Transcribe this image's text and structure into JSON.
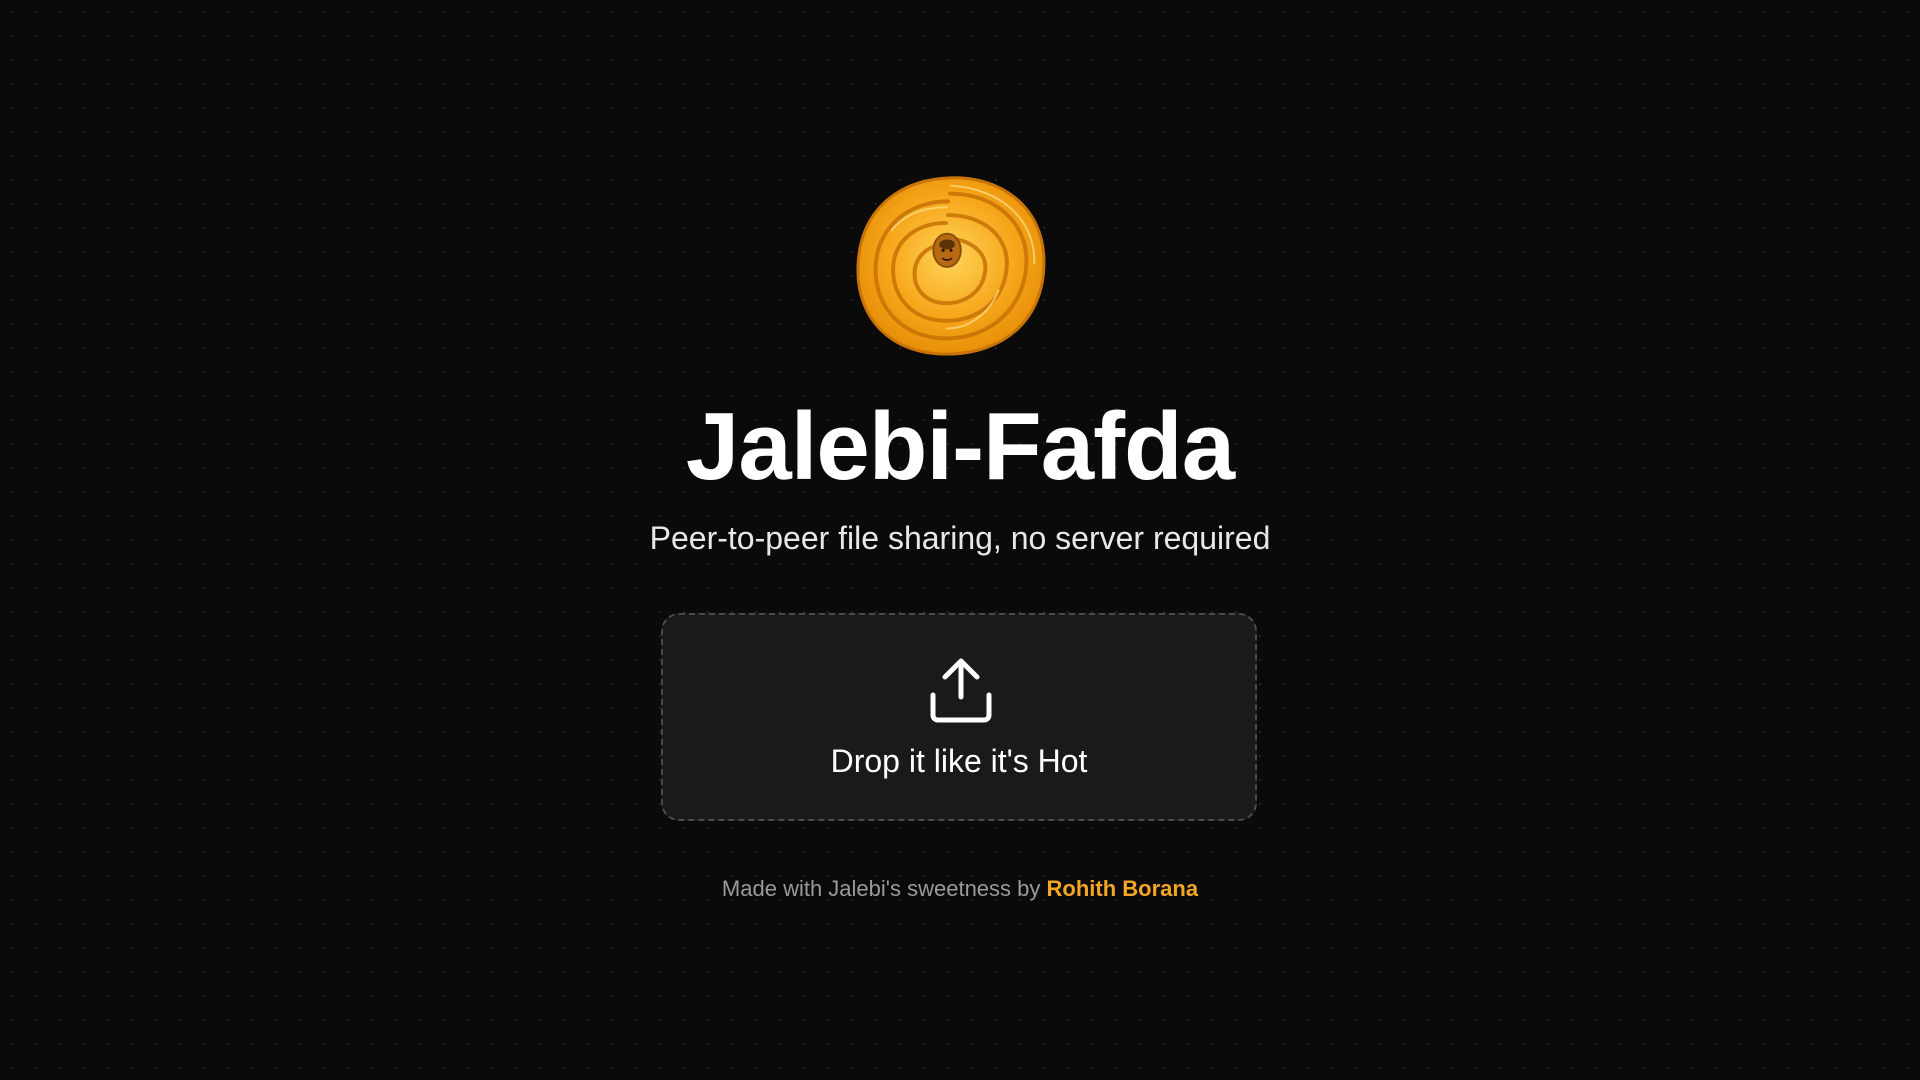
{
  "app": {
    "title": "Jalebi-Fafda",
    "subtitle": "Peer-to-peer file sharing, no server required",
    "logo_icon": "jalebi-logo-icon"
  },
  "dropzone": {
    "label": "Drop it like it's Hot",
    "icon": "upload-icon"
  },
  "footer": {
    "text": "Made with Jalebi's sweetness by",
    "author": "Rohith Borana"
  },
  "colors": {
    "background": "#0a0a0a",
    "dropzone_bg": "#1a1a1a",
    "accent": "#f5a623",
    "jalebi_orange": "#f29a0c"
  }
}
